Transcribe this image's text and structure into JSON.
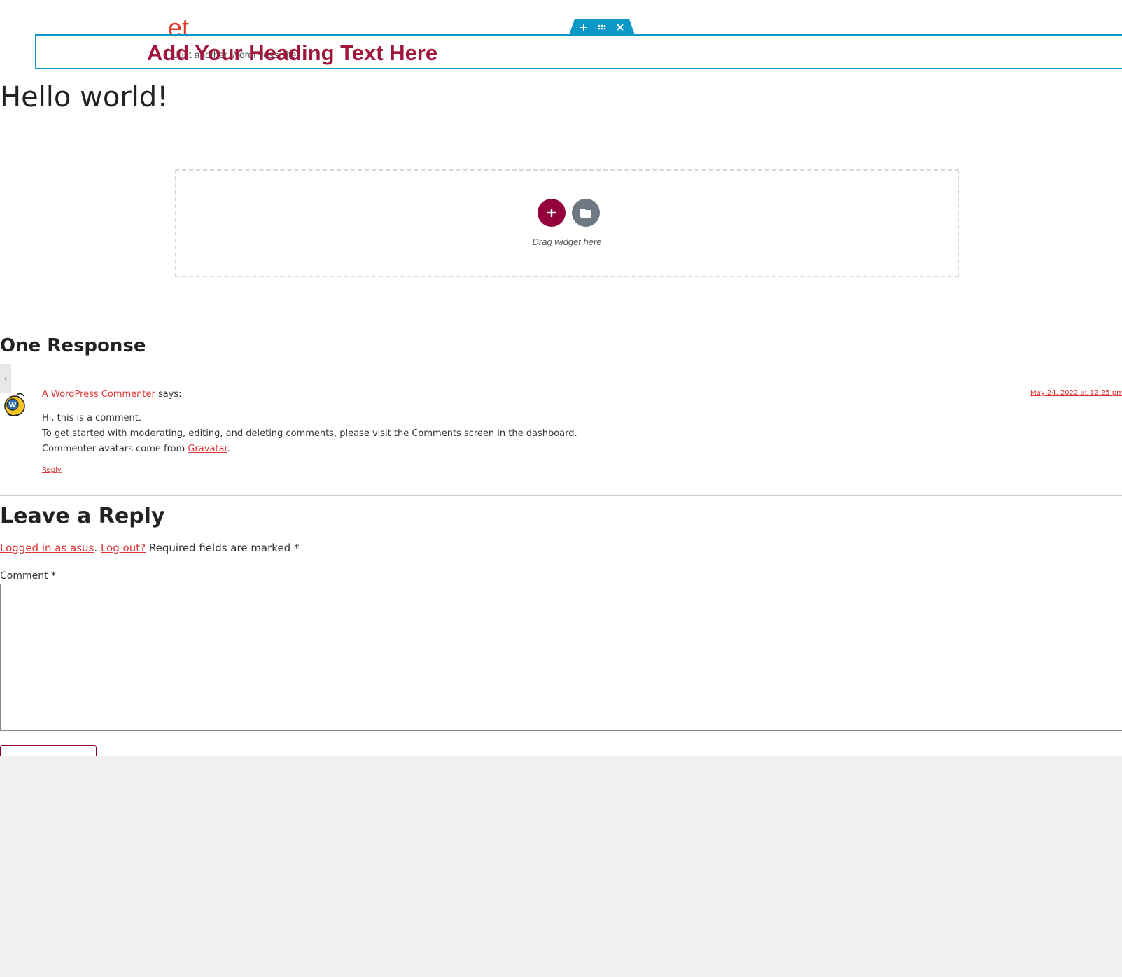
{
  "header": {
    "logo_text": "et",
    "tagline": "Just another WordPress site",
    "heading": "Add Your Heading Text Here",
    "handle": {
      "add_icon": "plus-icon",
      "move_icon": "grid-dots-icon",
      "delete_icon": "close-icon"
    }
  },
  "post": {
    "title": "Hello world!"
  },
  "dropzone": {
    "label": "Drag widget here",
    "add_icon": "plus-icon",
    "template_icon": "folder-icon"
  },
  "comments": {
    "title": "One Response",
    "items": [
      {
        "author": "A WordPress Commenter",
        "says": "says:",
        "date": "May 24, 2022 at 12:25 pm",
        "lines": [
          "Hi, this is a comment.",
          "To get started with moderating, editing, and deleting comments, please visit the Comments screen in the dashboard.",
          "Commenter avatars come from "
        ],
        "gravatar_link": "Gravatar",
        "period": ".",
        "reply": "Reply"
      }
    ]
  },
  "reply_form": {
    "title": "Leave a Reply",
    "logged_in_link": "Logged in as asus",
    "separator": ".",
    "logout_link": "Log out?",
    "required_note": " Required fields are marked *",
    "comment_label": "Comment *",
    "comment_value": ""
  },
  "colors": {
    "accent": "#93003c",
    "link": "#dd3333",
    "editor_blue": "#0c98c6",
    "heading_red": "#a0163c"
  }
}
